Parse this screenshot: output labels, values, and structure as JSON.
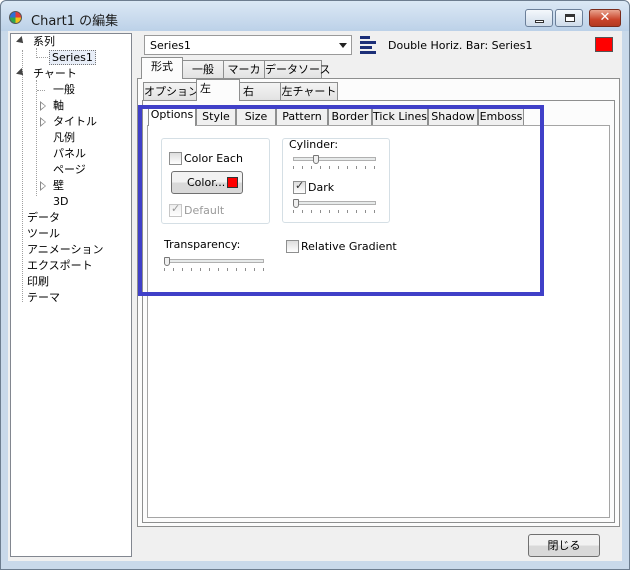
{
  "window": {
    "title": "Chart1 の編集"
  },
  "tree": {
    "series": "系列",
    "series1": "Series1",
    "chart": "チャート",
    "general": "一般",
    "axis": "軸",
    "title": "タイトル",
    "legend": "凡例",
    "panel": "パネル",
    "page": "ページ",
    "wall": "壁",
    "three_d": "3D",
    "data": "データ",
    "tools": "ツール",
    "animation": "アニメーション",
    "export": "エクスポート",
    "print": "印刷",
    "theme": "テーマ"
  },
  "series_select": {
    "value": "Series1"
  },
  "series_label": "Double Horiz. Bar: Series1",
  "series_color": "#ff0000",
  "tabs1": [
    "形式",
    "一般",
    "マーカ",
    "データソース"
  ],
  "tabs2": [
    "オプション",
    "左",
    "右",
    "左チャート"
  ],
  "tabs3": [
    "Options",
    "Style",
    "Size",
    "Pattern",
    "Border",
    "Tick Lines",
    "Shadow",
    "Emboss"
  ],
  "options": {
    "color_each": "Color Each",
    "color_button": "Color...",
    "default": "Default",
    "cylinder": "Cylinder:",
    "dark": "Dark",
    "transparency": "Transparency:",
    "relative_gradient": "Relative Gradient"
  },
  "close_button": "閉じる",
  "highlight_color": "#4040c8"
}
